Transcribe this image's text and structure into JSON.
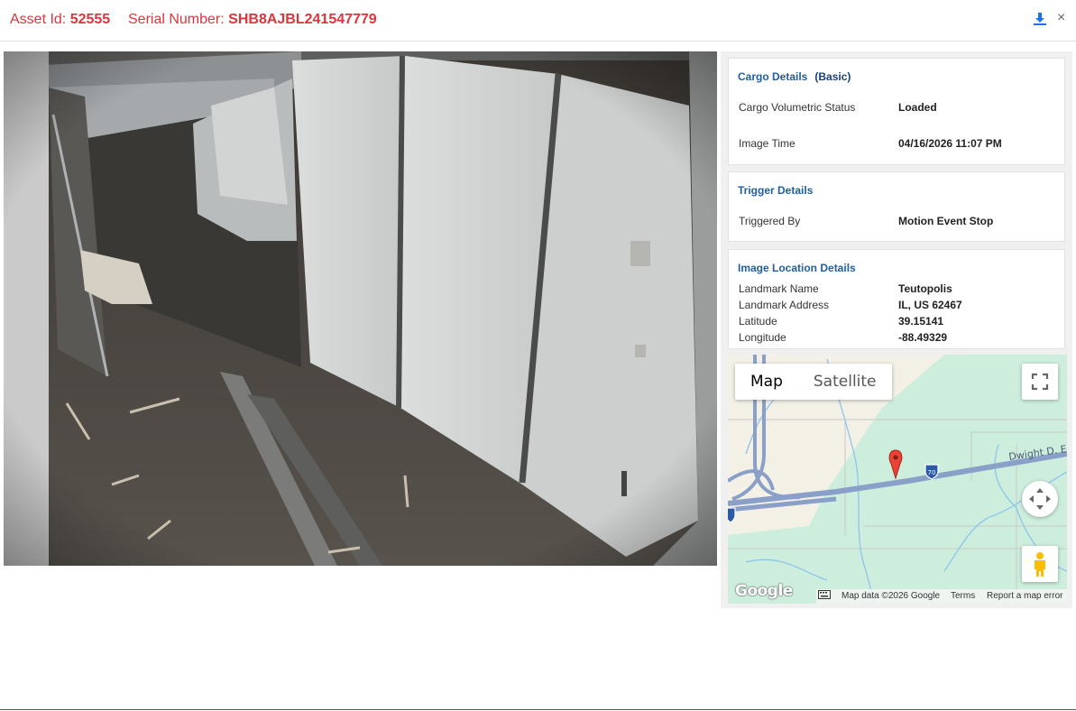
{
  "header": {
    "asset_label": "Asset Id:",
    "asset_value": "52555",
    "serial_label": "Serial Number:",
    "serial_value": "SHB8AJBL241547779",
    "download_icon": "download-icon",
    "close_icon": "close-icon",
    "close_glyph": "×"
  },
  "cargo": {
    "title": "Cargo Details",
    "mode": "(Basic)",
    "volumetric_label": "Cargo Volumetric Status",
    "volumetric_value": "Loaded",
    "time_label": "Image Time",
    "time_value": "04/16/2026 11:07 PM"
  },
  "trigger": {
    "title": "Trigger Details",
    "by_label": "Triggered By",
    "by_value": "Motion Event Stop"
  },
  "location": {
    "title": "Image Location Details",
    "landmark_name_label": "Landmark Name",
    "landmark_name_value": "Teutopolis",
    "landmark_address_label": "Landmark Address",
    "landmark_address_value": "IL, US 62467",
    "latitude_label": "Latitude",
    "latitude_value": "39.15141",
    "longitude_label": "Longitude",
    "longitude_value": "-88.49329"
  },
  "map": {
    "type_map": "Map",
    "type_satellite": "Satellite",
    "road_label": "Dwight D. Ei",
    "shield_label": "70",
    "google_logo": "Google",
    "attribution": "Map data ©2026 Google",
    "terms": "Terms",
    "report": "Report a map error",
    "icons": [
      "fullscreen-icon",
      "compass-icon",
      "pegman-icon",
      "map-pin-icon",
      "keyboard-icon"
    ]
  },
  "colors": {
    "accent_red": "#d9363e",
    "title_blue": "#1f5fa0",
    "download_blue": "#1a73e8"
  }
}
